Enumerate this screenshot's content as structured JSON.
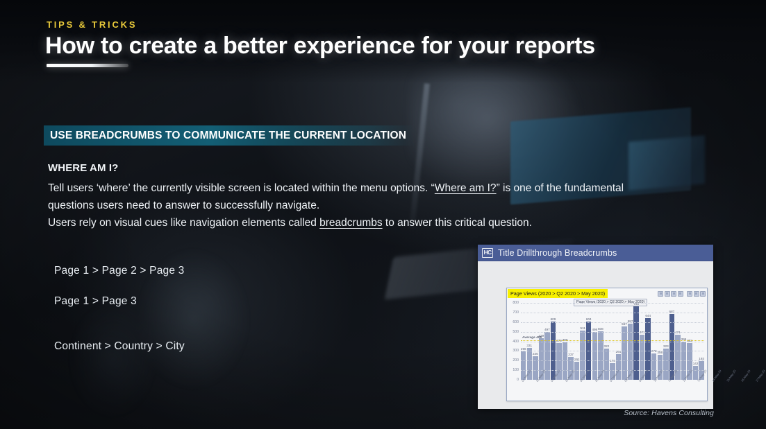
{
  "header": {
    "kicker": "TIPS & TRICKS",
    "title": "How to create a better experience for your reports"
  },
  "section": {
    "bar_label": "USE BREADCRUMBS TO COMMUNICATE THE CURRENT LOCATION",
    "subhead": "WHERE AM I?",
    "paragraph_part1": "Tell users ‘where’ the currently visible screen is located within the menu options. “",
    "paragraph_underline1": "Where am I?",
    "paragraph_part2": "” is one of the fundamental questions users need to answer to successfully navigate.",
    "paragraph_part3": "Users rely on visual cues like navigation elements called ",
    "paragraph_underline2": "breadcrumbs",
    "paragraph_part4": " to answer this critical question."
  },
  "breadcrumb_examples": {
    "example1": "Page 1 > Page 2 > Page 3",
    "example2": "Page 1 > Page 3",
    "example3": "Continent > Country > City"
  },
  "report": {
    "logo": "HC",
    "window_title": "Title Drillthrough Breadcrumbs",
    "tooltip_chip": "Page Views (2020 > Q2 2020 > May 2020)"
  },
  "source_note": "Source: Havens Consulting",
  "colors": {
    "kicker_yellow": "#e8c93a",
    "section_teal": "#135e74",
    "highlight_yellow": "#f7f000",
    "bar_light": "#9aa6c4",
    "bar_dark": "#4e5f8e",
    "average_line": "#e0c41a",
    "titlebar_blue": "#4a5d96"
  },
  "chart_data": {
    "type": "bar",
    "title": "Page Views (2020 > Q2 2020 > May 2020)",
    "xlabel": "",
    "ylabel": "",
    "ylim": [
      0,
      800
    ],
    "yticks": [
      0,
      100,
      200,
      300,
      400,
      500,
      600,
      700,
      800
    ],
    "grid": true,
    "legend": "none",
    "average": 408,
    "average_label": "Average 408",
    "categories": [
      "01-May-20",
      "02-May-20",
      "03-May-20",
      "04-May-20",
      "05-May-20",
      "06-May-20",
      "07-May-20",
      "08-May-20",
      "09-May-20",
      "10-May-20",
      "11-May-20",
      "12-May-20",
      "13-May-20",
      "14-May-20",
      "15-May-20",
      "16-May-20",
      "17-May-20",
      "18-May-20",
      "19-May-20",
      "20-May-20",
      "21-May-20",
      "22-May-20",
      "23-May-20",
      "24-May-20",
      "25-May-20",
      "26-May-20",
      "27-May-20",
      "28-May-20",
      "29-May-20",
      "30-May-20",
      "31-May-20"
    ],
    "values": [
      296,
      331,
      246,
      429,
      497,
      609,
      379,
      389,
      237,
      191,
      511,
      604,
      498,
      508,
      322,
      176,
      264,
      557,
      587,
      763,
      471,
      644,
      272,
      256,
      323,
      687,
      471,
      396,
      383,
      142,
      193
    ],
    "highlighted_indices": [
      5,
      11,
      19,
      21,
      25
    ],
    "series": [
      {
        "name": "Page Views",
        "values": [
          296,
          331,
          246,
          429,
          497,
          609,
          379,
          389,
          237,
          191,
          511,
          604,
          498,
          508,
          322,
          176,
          264,
          557,
          587,
          763,
          471,
          644,
          272,
          256,
          323,
          687,
          471,
          396,
          383,
          142,
          193
        ]
      }
    ],
    "toolbar_icons": [
      "filter-icon",
      "drill-down-icon",
      "drill-up-icon",
      "expand-icon",
      "focus-icon",
      "filter-panel-icon",
      "focus-mode-icon",
      "more-options-icon"
    ]
  }
}
